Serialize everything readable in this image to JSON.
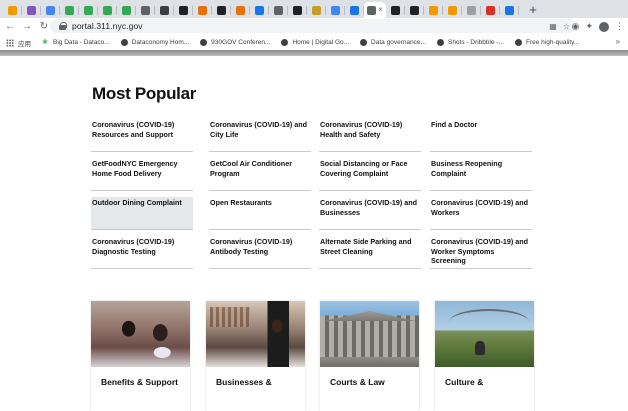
{
  "browser": {
    "tabs": [
      {
        "color": "#f29900"
      },
      {
        "color": "#7e57c2"
      },
      {
        "color": "#4285f4"
      },
      {
        "color": "#34a853"
      },
      {
        "color": "#34a853"
      },
      {
        "color": "#34a853"
      },
      {
        "color": "#34a853"
      },
      {
        "color": "#5f6368"
      },
      {
        "color": "#3c4043"
      },
      {
        "color": "#202124"
      },
      {
        "color": "#e8710a"
      },
      {
        "color": "#202124"
      },
      {
        "color": "#e8710a"
      },
      {
        "color": "#1a73e8"
      },
      {
        "color": "#5f6368"
      },
      {
        "color": "#202124"
      },
      {
        "color": "#c69c2b"
      },
      {
        "color": "#4285f4"
      },
      {
        "color": "#1a73e8"
      },
      {
        "color": "#202124"
      },
      {
        "color": "#202124"
      },
      {
        "color": "#f29900"
      },
      {
        "color": "#f29900"
      },
      {
        "color": "#9aa0a6"
      },
      {
        "color": "#d93025"
      },
      {
        "color": "#1a73e8"
      }
    ],
    "active_tab_close": "×",
    "new_tab_label": "+",
    "url": "portal.311.nyc.gov",
    "bookmarks": [
      {
        "label": "应用",
        "icon": "apps-icon"
      },
      {
        "label": "Big Data - Dataco...",
        "icon": "leaf-icon"
      },
      {
        "label": "Dataconomy Hom...",
        "icon": "globe-icon"
      },
      {
        "label": "930GOV Conferen...",
        "icon": "globe-icon"
      },
      {
        "label": "Home | Digital Go...",
        "icon": "globe-icon"
      },
      {
        "label": "Data governance...",
        "icon": "globe-icon"
      },
      {
        "label": "Shots - Dribbble -...",
        "icon": "globe-icon"
      },
      {
        "label": "Free high-quality...",
        "icon": "globe-icon"
      }
    ],
    "bookmarks_more": "»"
  },
  "page": {
    "heading": "Most Popular",
    "popular": [
      "Coronavirus (COVID-19) Resources and Support",
      "Coronavirus (COVID-19) and City Life",
      "Coronavirus (COVID-19) Health and Safety",
      "Find a Doctor",
      "GetFoodNYC Emergency Home Food Delivery",
      "GetCool Air Conditioner Program",
      "Social Distancing or Face Covering Complaint",
      "Business Reopening Complaint",
      "Outdoor Dining Complaint",
      "Open Restaurants",
      "Coronavirus (COVID-19) and Businesses",
      "Coronavirus (COVID-19) and Workers",
      "Coronavirus (COVID-19) Diagnostic Testing",
      "Coronavirus (COVID-19) Antibody Testing",
      "Alternate Side Parking and Street Cleaning",
      "Coronavirus (COVID-19) and Worker Symptoms Screening"
    ],
    "highlighted_index": 8,
    "cards": [
      {
        "caption": "Benefits & Support"
      },
      {
        "caption": "Businesses &"
      },
      {
        "caption": "Courts & Law"
      },
      {
        "caption": "Culture &"
      }
    ]
  }
}
